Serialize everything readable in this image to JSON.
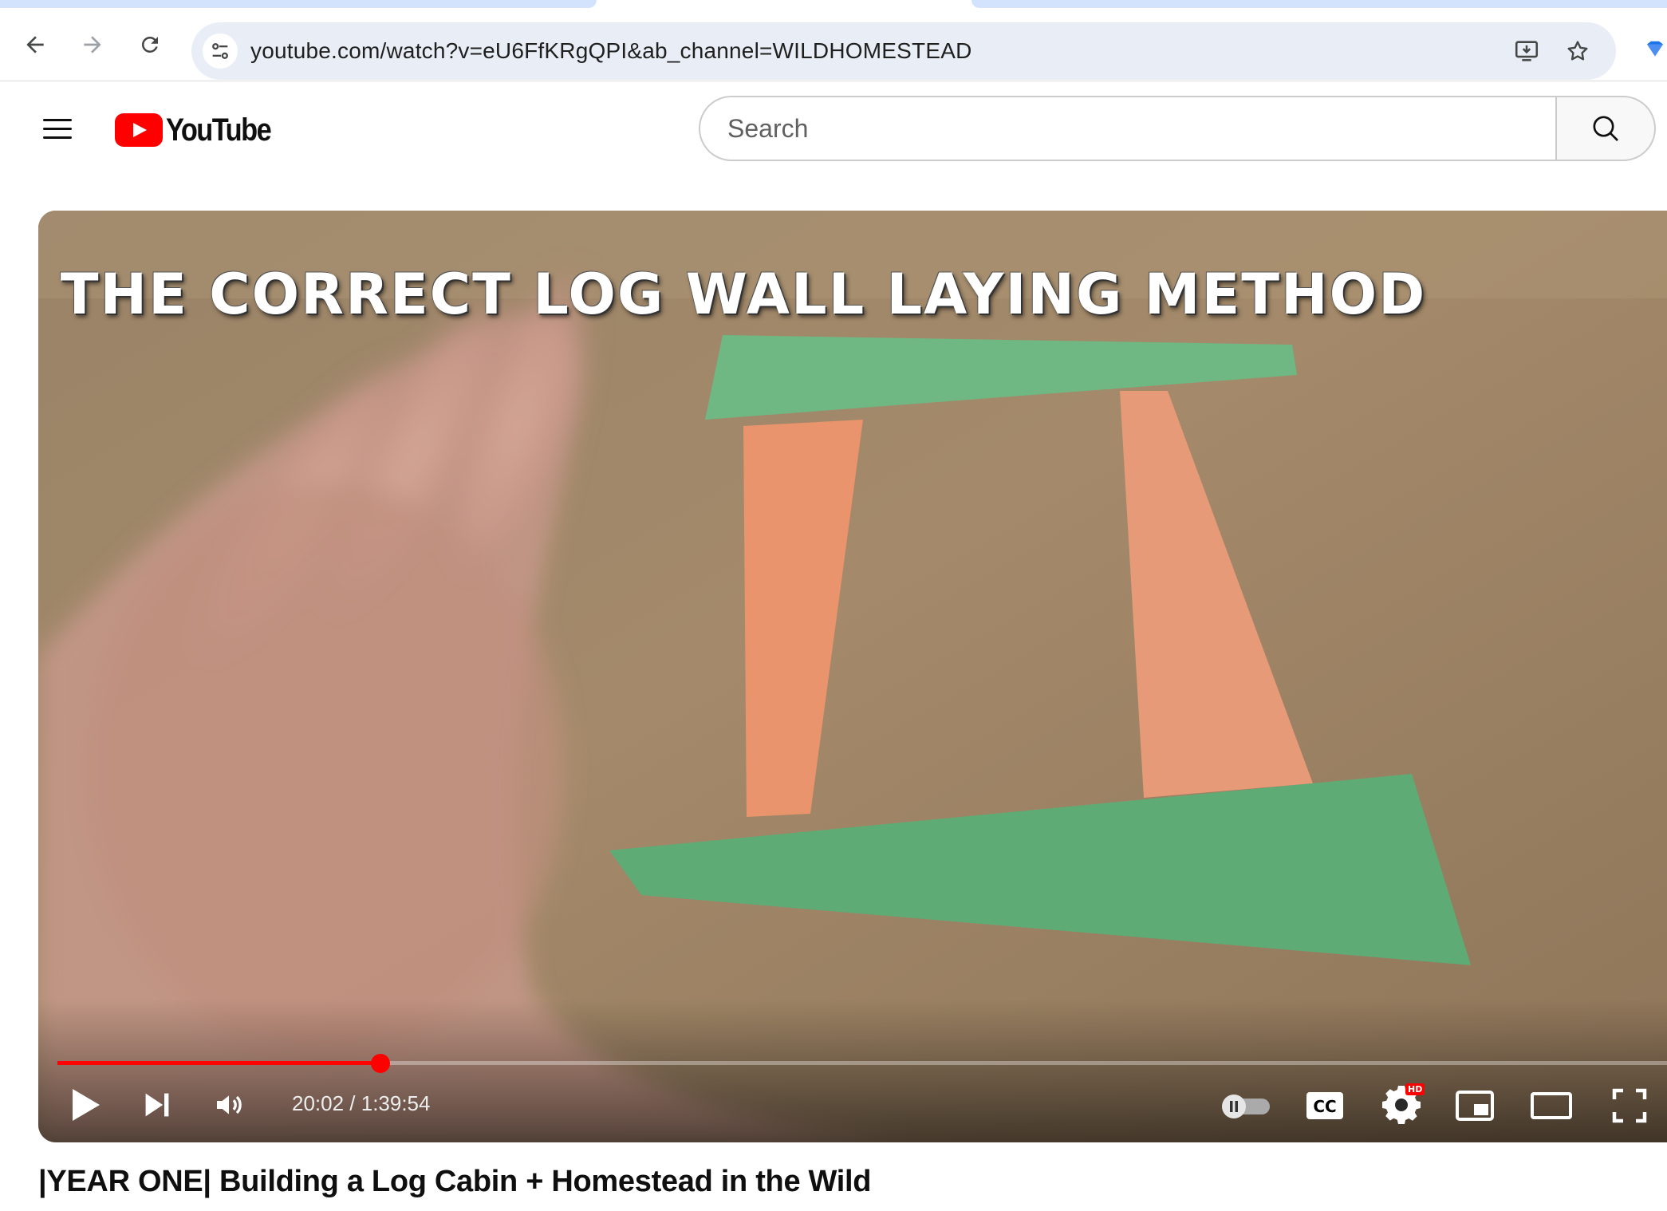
{
  "browser": {
    "url": "youtube.com/watch?v=eU6FfKRgQPI&ab_channel=WILDHOMESTEAD",
    "icons": [
      "back-arrow-icon",
      "forward-arrow-icon",
      "reload-icon",
      "site-settings-icon",
      "install-app-icon",
      "bookmark-star-icon",
      "extension-icon"
    ]
  },
  "masthead": {
    "logo_text": "YouTube",
    "search_placeholder": "Search",
    "brand_color": "#ff0000"
  },
  "player": {
    "overlay_title": "THE CORRECT LOG WALL LAYING METHOD",
    "time_display": "20:02 / 1:39:54",
    "progress_fraction": 0.2005,
    "hd_badge": "HD",
    "cc_label": "CC",
    "autoplay_on": false,
    "progress_color": "#ff0000"
  },
  "video": {
    "title": "|YEAR ONE| Building a Log Cabin + Homestead in the Wild"
  }
}
